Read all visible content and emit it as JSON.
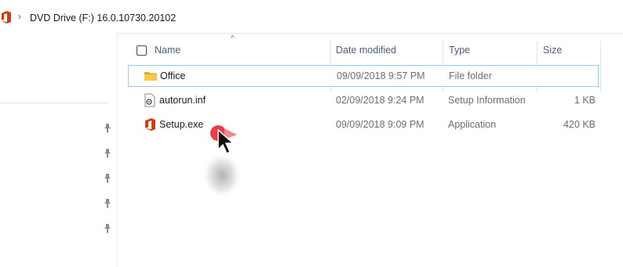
{
  "address_bar": {
    "path": "DVD Drive (F:) 16.0.10730.20102",
    "chevron": "›"
  },
  "columns": {
    "name": "Name",
    "date_modified": "Date modified",
    "type": "Type",
    "size": "Size"
  },
  "files": [
    {
      "name": "Office",
      "date_modified": "09/09/2018 9:57 PM",
      "type": "File folder",
      "size": "",
      "icon": "folder-icon",
      "selected": true
    },
    {
      "name": "autorun.inf",
      "date_modified": "02/09/2018 9:24 PM",
      "type": "Setup Information",
      "size": "1 KB",
      "icon": "settings-file-icon",
      "selected": false
    },
    {
      "name": "Setup.exe",
      "date_modified": "09/09/2018 9:09 PM",
      "type": "Application",
      "size": "420 KB",
      "icon": "office-logo-icon",
      "selected": false
    }
  ],
  "colors": {
    "office_orange": "#d83b01",
    "folder_yellow": "#f8c94a",
    "selection_border": "#99c9ef",
    "header_text": "#4c607a",
    "click_indicator": "#ea3d46"
  },
  "sort": {
    "column": "name",
    "direction": "ascending",
    "glyph": "^"
  }
}
